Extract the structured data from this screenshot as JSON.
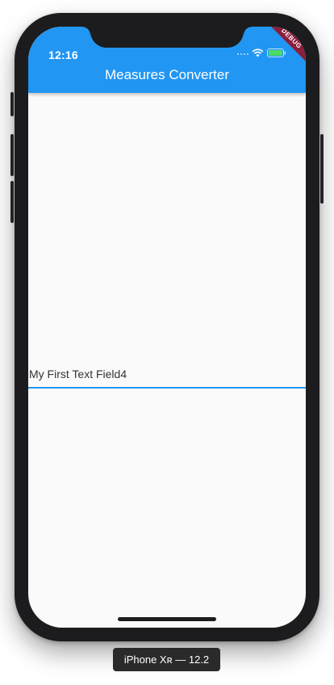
{
  "status_bar": {
    "time": "12:16"
  },
  "app_bar": {
    "title": "Measures Converter",
    "background": "#2196f3"
  },
  "debug_banner": {
    "label": "DEBUG",
    "color": "#8b1e3a"
  },
  "text_field": {
    "value": "My First Text Field4",
    "underline_color": "#2196f3"
  },
  "device": {
    "label": "iPhone Xʀ — 12.2"
  },
  "icons": {
    "wifi": "wifi-icon",
    "battery": "battery-icon",
    "signal": "signal-icon"
  }
}
